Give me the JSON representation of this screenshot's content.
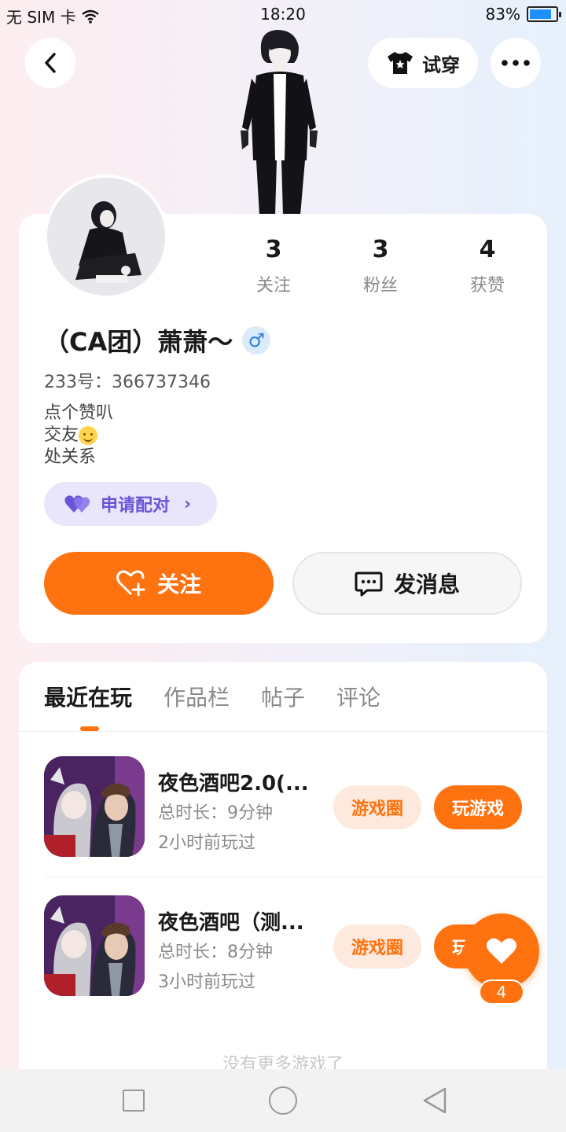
{
  "status_bar": {
    "carrier": "无 SIM 卡",
    "time": "18:20",
    "battery": "83%",
    "battery_level": 0.83
  },
  "header": {
    "tryon_label": "试穿"
  },
  "profile": {
    "stats": [
      {
        "value": "3",
        "label": "关注"
      },
      {
        "value": "3",
        "label": "粉丝"
      },
      {
        "value": "4",
        "label": "获赞"
      }
    ],
    "name": "（CA团）萧萧〜",
    "gender_symbol": "♂",
    "uid": "233号：366737346",
    "bio": [
      "点个赞叭",
      "交友",
      "处关系"
    ],
    "pair_label": "申请配对",
    "follow_label": "关注",
    "message_label": "发消息"
  },
  "tabs": [
    "最近在玩",
    "作品栏",
    "帖子",
    "评论"
  ],
  "games": [
    {
      "title": "夜色酒吧2.0(...",
      "duration": "总时长：9分钟",
      "last_played": "2小时前玩过",
      "circle_label": "游戏圈",
      "play_label": "玩游戏"
    },
    {
      "title": "夜色酒吧（测...",
      "duration": "总时长：8分钟",
      "last_played": "3小时前玩过",
      "circle_label": "游戏圈",
      "play_label": "玩游戏"
    }
  ],
  "no_more_text": "没有更多游戏了",
  "like": {
    "count": "4"
  },
  "colors": {
    "accent": "#ff7210",
    "pair": "#6a55d8"
  }
}
